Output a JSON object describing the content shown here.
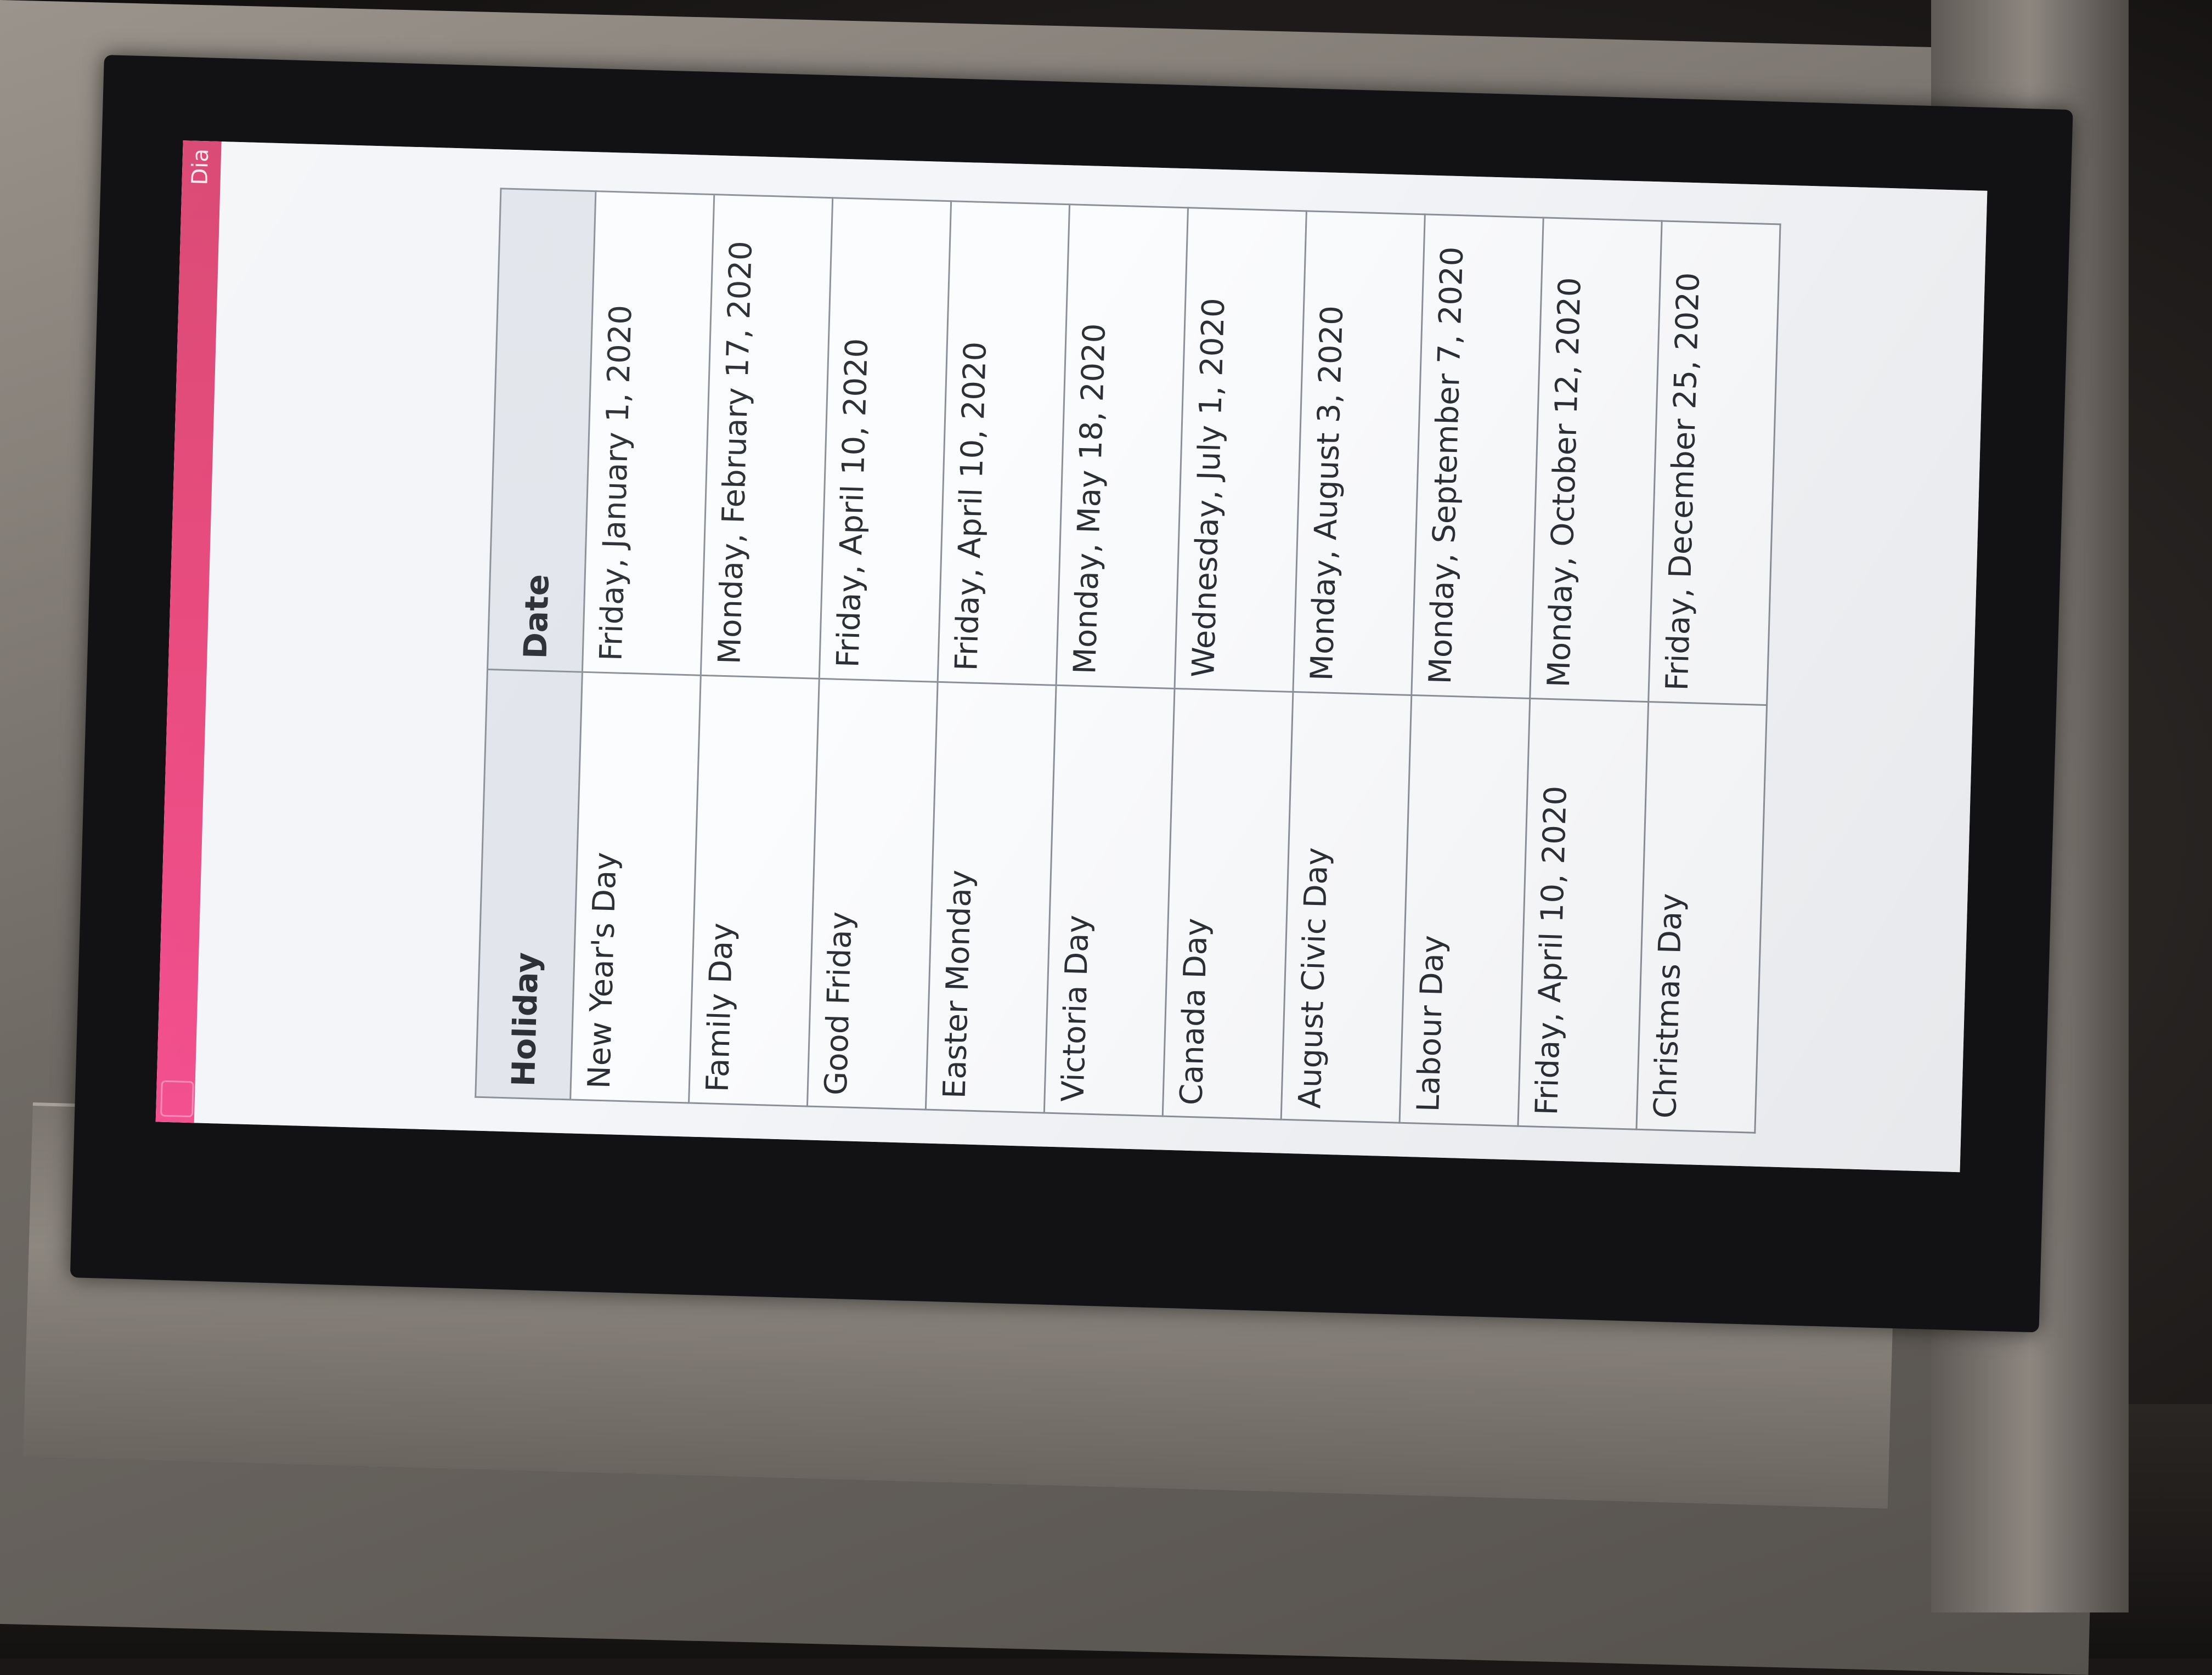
{
  "app": {
    "title": "Dia"
  },
  "table": {
    "headers": {
      "holiday": "Holiday",
      "date": "Date"
    },
    "rows": [
      {
        "holiday": "New Year's Day",
        "date": "Friday, January 1, 2020"
      },
      {
        "holiday": "Family Day",
        "date": "Monday, February 17, 2020"
      },
      {
        "holiday": "Good Friday",
        "date": "Friday, April 10, 2020"
      },
      {
        "holiday": "Easter Monday",
        "date": "Friday, April 10, 2020"
      },
      {
        "holiday": "Victoria Day",
        "date": "Monday, May 18, 2020"
      },
      {
        "holiday": "Canada Day",
        "date": "Wednesday, July 1, 2020"
      },
      {
        "holiday": "August Civic Day",
        "date": "Monday, August 3, 2020"
      },
      {
        "holiday": "Labour Day",
        "date": "Monday, September 7, 2020"
      },
      {
        "holiday": "Friday, April 10, 2020",
        "date": "Monday, October 12, 2020"
      },
      {
        "holiday": "Christmas Day",
        "date": "Friday, December 25, 2020"
      }
    ]
  },
  "colors": {
    "topbar": "#e8457a",
    "header_bg": "#e2e6ec",
    "border": "#8c9098"
  }
}
